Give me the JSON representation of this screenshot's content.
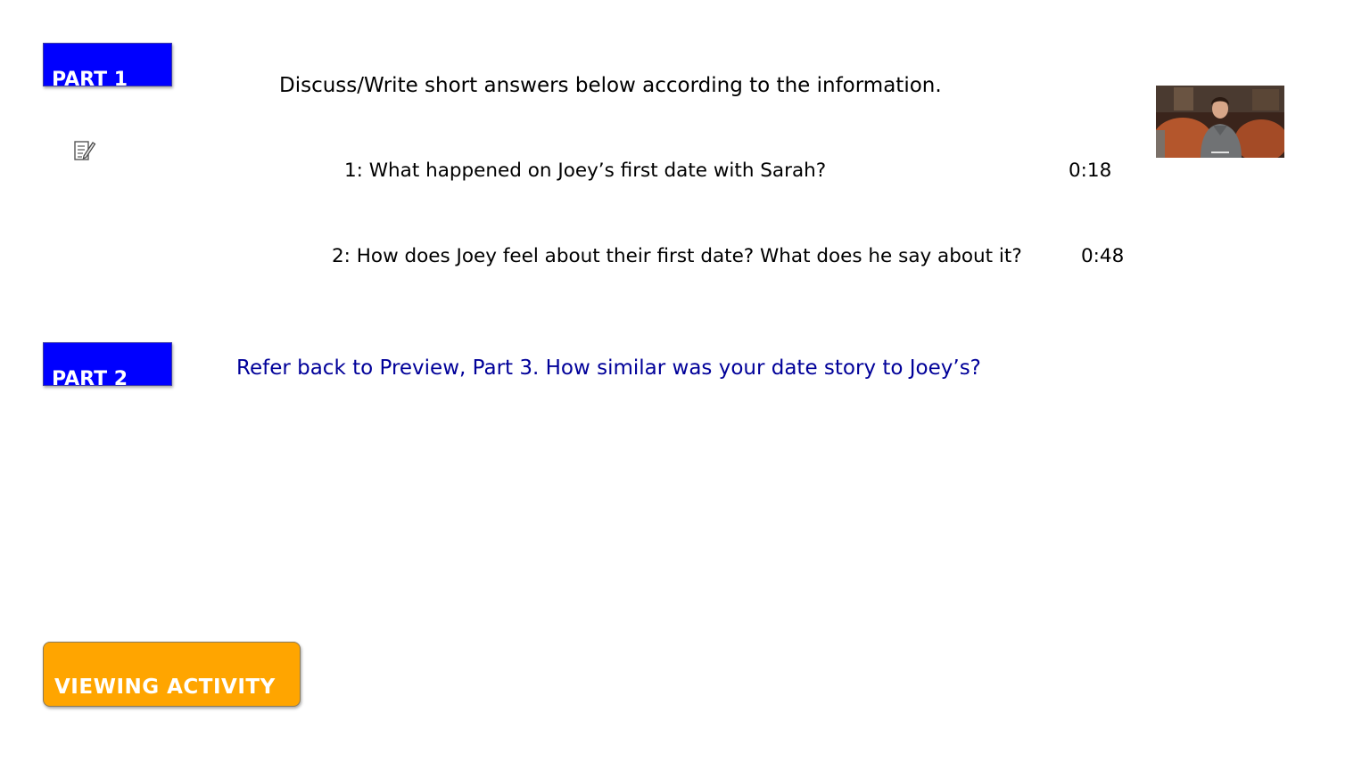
{
  "part1": {
    "label": "PART 1",
    "instruction": "Discuss/Write short answers below according to the information.",
    "questions": [
      {
        "text": "1: What happened on Joey’s first date with Sarah?",
        "time": "0:18"
      },
      {
        "text": "2: How does Joey feel about their first date? What does he say about it?",
        "time": "0:48"
      }
    ]
  },
  "part2": {
    "label": "PART 2",
    "text": "Refer back to Preview, Part 3. How similar was your date story to Joey’s?"
  },
  "activity_label": "VIEWING ACTIVITY",
  "colors": {
    "part_tab": "#0000ff",
    "part2_text": "#000099",
    "activity_button": "#ffa500"
  },
  "icons": {
    "notes": "notepad-pencil-icon",
    "video": "video-thumbnail"
  }
}
